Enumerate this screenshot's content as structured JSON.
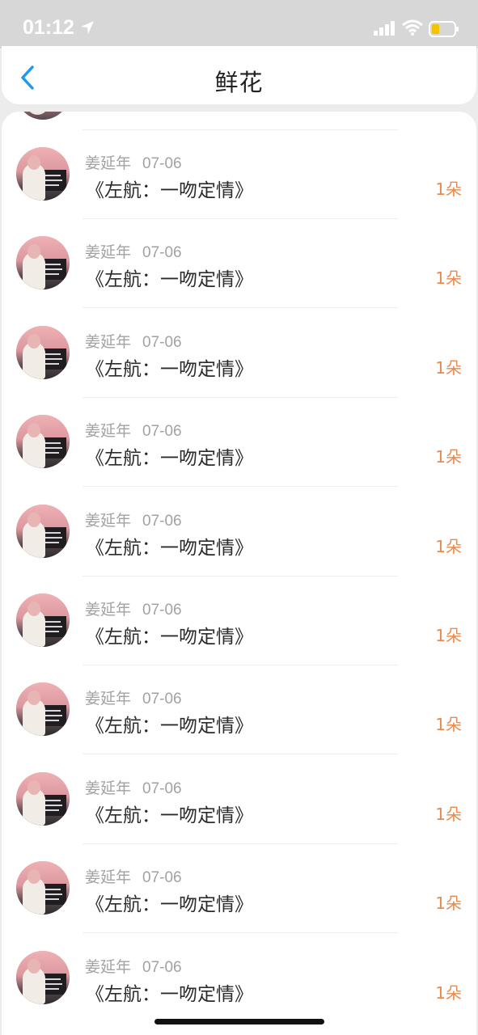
{
  "status_bar": {
    "time": "01:12",
    "colors": {
      "background": "#d7d7d7",
      "battery_level": "#f5c400"
    }
  },
  "nav": {
    "title": "鲜花",
    "back_icon": "chevron-left-icon",
    "colors": {
      "back": "#1e9be8"
    }
  },
  "list": {
    "items": [
      {
        "name": "姜延年",
        "date": "07-06",
        "title": "《左航：一吻定情》",
        "count": "1朵"
      },
      {
        "name": "姜延年",
        "date": "07-06",
        "title": "《左航：一吻定情》",
        "count": "1朵"
      },
      {
        "name": "姜延年",
        "date": "07-06",
        "title": "《左航：一吻定情》",
        "count": "1朵"
      },
      {
        "name": "姜延年",
        "date": "07-06",
        "title": "《左航：一吻定情》",
        "count": "1朵"
      },
      {
        "name": "姜延年",
        "date": "07-06",
        "title": "《左航：一吻定情》",
        "count": "1朵"
      },
      {
        "name": "姜延年",
        "date": "07-06",
        "title": "《左航：一吻定情》",
        "count": "1朵"
      },
      {
        "name": "姜延年",
        "date": "07-06",
        "title": "《左航：一吻定情》",
        "count": "1朵"
      },
      {
        "name": "姜延年",
        "date": "07-06",
        "title": "《左航：一吻定情》",
        "count": "1朵"
      },
      {
        "name": "姜延年",
        "date": "07-06",
        "title": "《左航：一吻定情》",
        "count": "1朵"
      },
      {
        "name": "姜延年",
        "date": "07-06",
        "title": "《左航：一吻定情》",
        "count": "1朵"
      }
    ],
    "colors": {
      "count": "#e98a4e",
      "meta": "#a2a2a2"
    }
  }
}
